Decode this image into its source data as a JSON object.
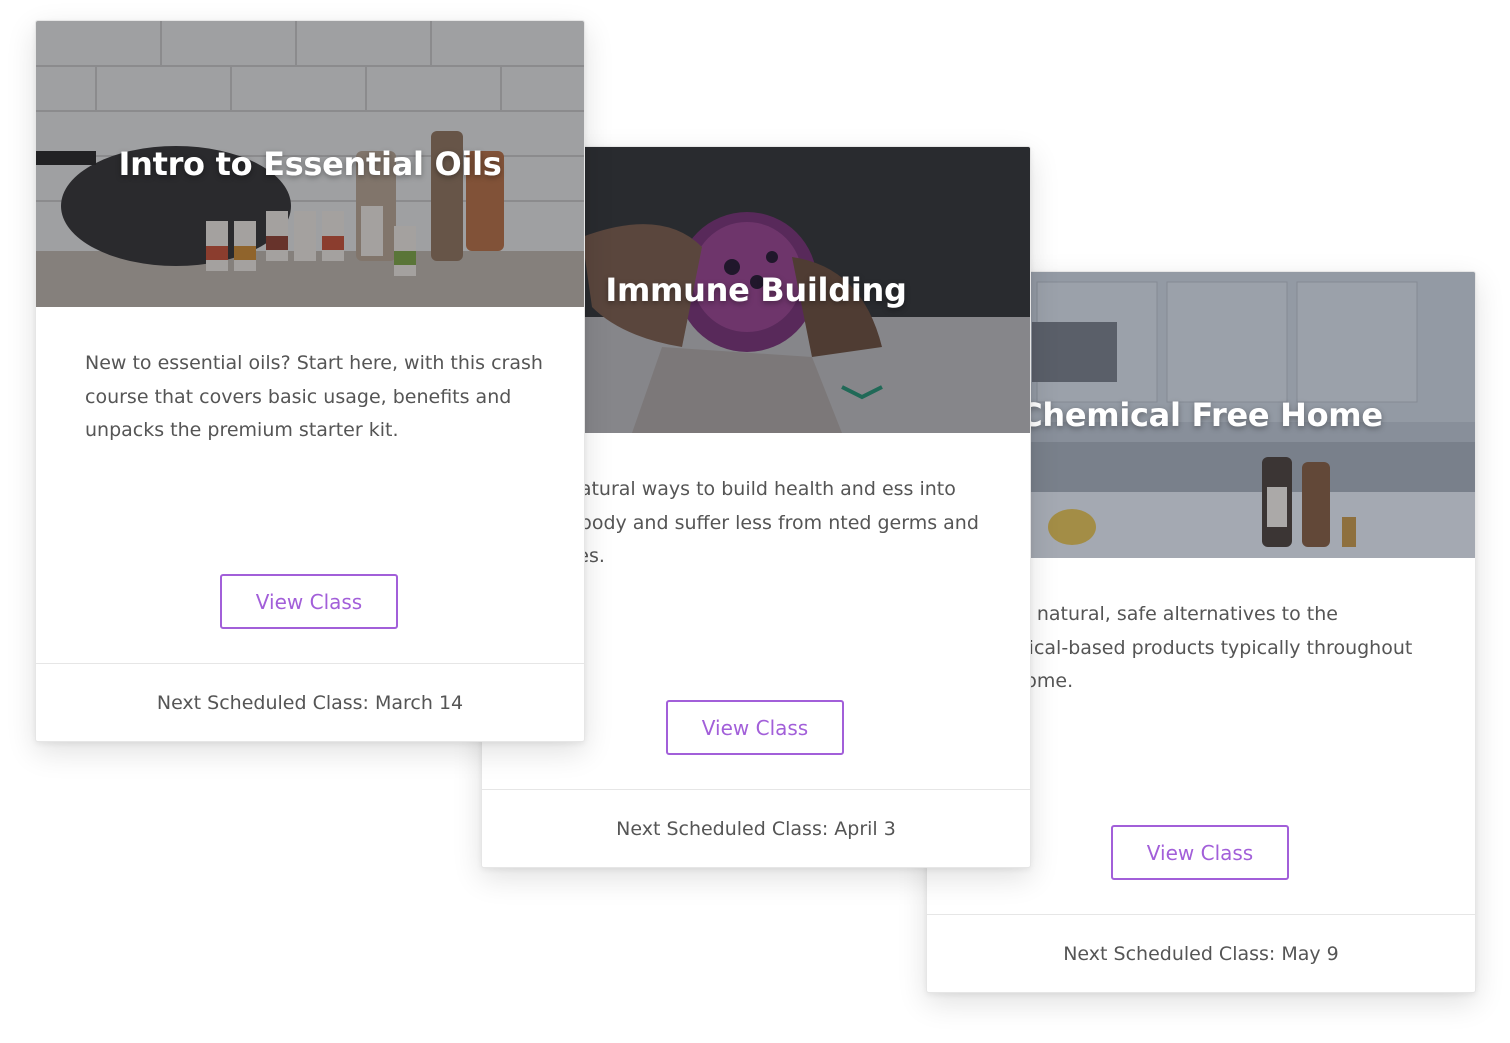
{
  "cards": [
    {
      "title": "Intro to Essential Oils",
      "description": "New to essential oils? Start here, with this crash course that covers basic usage, benefits and unpacks the premium starter kit.",
      "button_label": "View Class",
      "next_class": "Next Scheduled Class: March 14"
    },
    {
      "title": "Immune Building",
      "description": "ver natural ways to build health and ess into your body and suffer less from nted germs and viruses.",
      "button_label": "View Class",
      "next_class": "Next Scheduled Class: April 3"
    },
    {
      "title": "Chemical Free Home",
      "description": " about natural, safe alternatives to the chemical-based products typically  throughout the home.",
      "button_label": "View Class",
      "next_class": "Next Scheduled Class: May 9"
    }
  ],
  "colors": {
    "accent": "#a25fd9",
    "body_text": "#555555",
    "divider": "#e6e6e6"
  }
}
